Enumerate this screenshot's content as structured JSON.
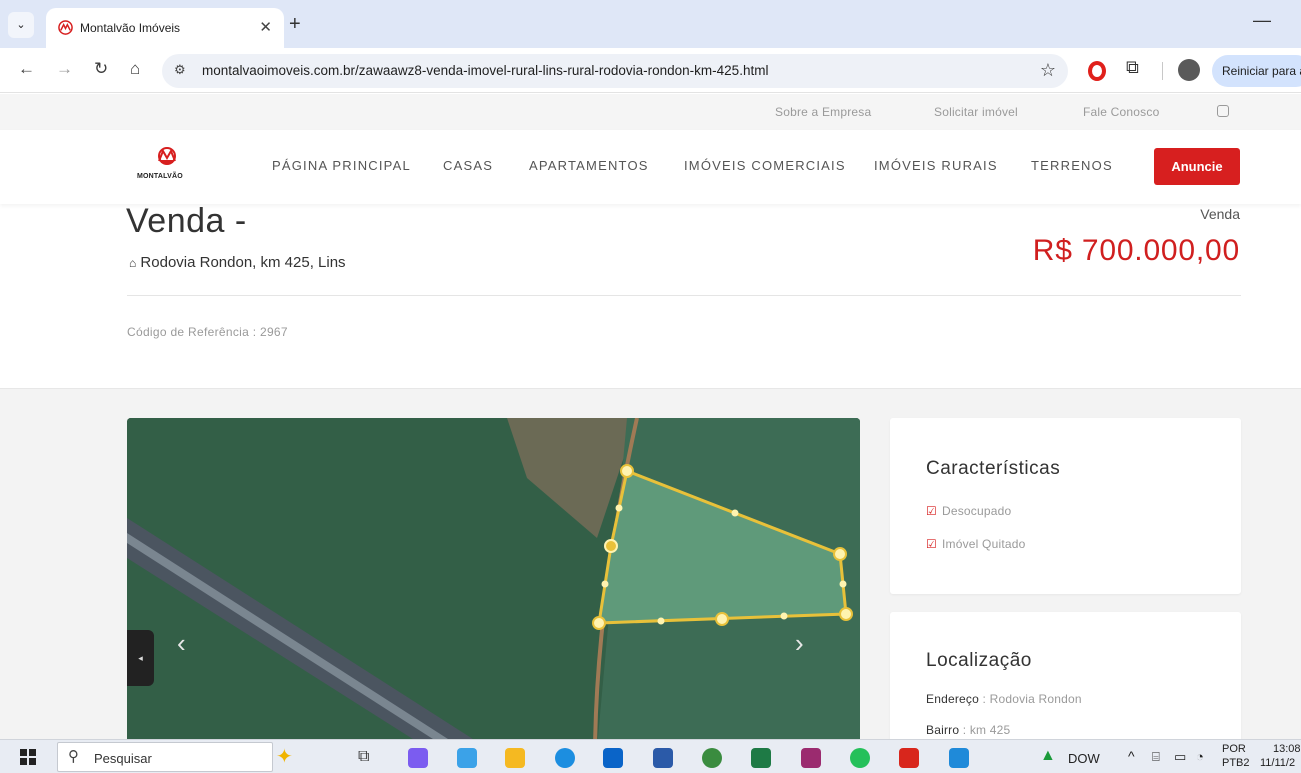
{
  "browser": {
    "tab_title": "Montalvão Imóveis",
    "url": "montalvaoimoveis.com.br/zawaawz8-venda-imovel-rural-lins-rural-rodovia-rondon-km-425.html",
    "restart_label": "Reiniciar para a"
  },
  "topbar": {
    "links": [
      "Sobre a Empresa",
      "Solicitar imóvel",
      "Fale Conosco"
    ]
  },
  "logo": {
    "text": "MONTALVÃO"
  },
  "nav": {
    "items": [
      "PÁGINA PRINCIPAL",
      "CASAS",
      "APARTAMENTOS",
      "IMÓVEIS COMERCIAIS",
      "IMÓVEIS RURAIS",
      "TERRENOS"
    ],
    "cta": "Anuncie"
  },
  "property": {
    "title": "Venda -",
    "address": "Rodovia Rondon, km 425, Lins",
    "type": "Venda",
    "price": "R$ 700.000,00",
    "reference_label": "Código de Referência",
    "reference": "2967"
  },
  "features_card": {
    "title": "Características",
    "items": [
      "Desocupado",
      "Imóvel Quitado"
    ]
  },
  "location_card": {
    "title": "Localização",
    "address_label": "Endereço",
    "address_value": "Rodovia Rondon",
    "bairro_label": "Bairro",
    "bairro_value": "km 425"
  },
  "taskbar": {
    "search_placeholder": "Pesquisar",
    "weather": "DOW",
    "lang": "POR",
    "layout": "PTB2",
    "time": "13:08",
    "date": "11/11/2"
  },
  "colors": {
    "accent_red": "#d71f1f",
    "price_red": "#d01f1f"
  }
}
